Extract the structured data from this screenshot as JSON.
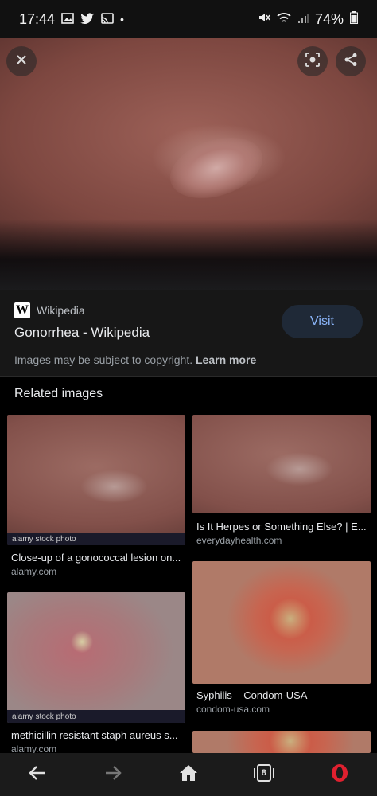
{
  "status": {
    "time": "17:44",
    "battery": "74%"
  },
  "hero": {
    "close_icon": "close-icon",
    "lens_icon": "lens-icon",
    "share_icon": "share-icon"
  },
  "result": {
    "source": "Wikipedia",
    "title": "Gonorrhea - Wikipedia",
    "visit_label": "Visit",
    "copyright_text": "Images may be subject to copyright.",
    "learn_more": "Learn more"
  },
  "related": {
    "heading": "Related images",
    "items": [
      {
        "caption": "Close-up of a gonococcal lesion on...",
        "domain": "alamy.com",
        "stock": "alamy stock photo"
      },
      {
        "caption": "Is It Herpes or Something Else? | E...",
        "domain": "everydayhealth.com"
      },
      {
        "caption": "methicillin resistant staph aureus s...",
        "domain": "alamy.com",
        "stock": "alamy stock photo"
      },
      {
        "caption": "Syphilis – Condom-USA",
        "domain": "condom-usa.com"
      }
    ]
  },
  "nav": {
    "tab_count": "8"
  }
}
